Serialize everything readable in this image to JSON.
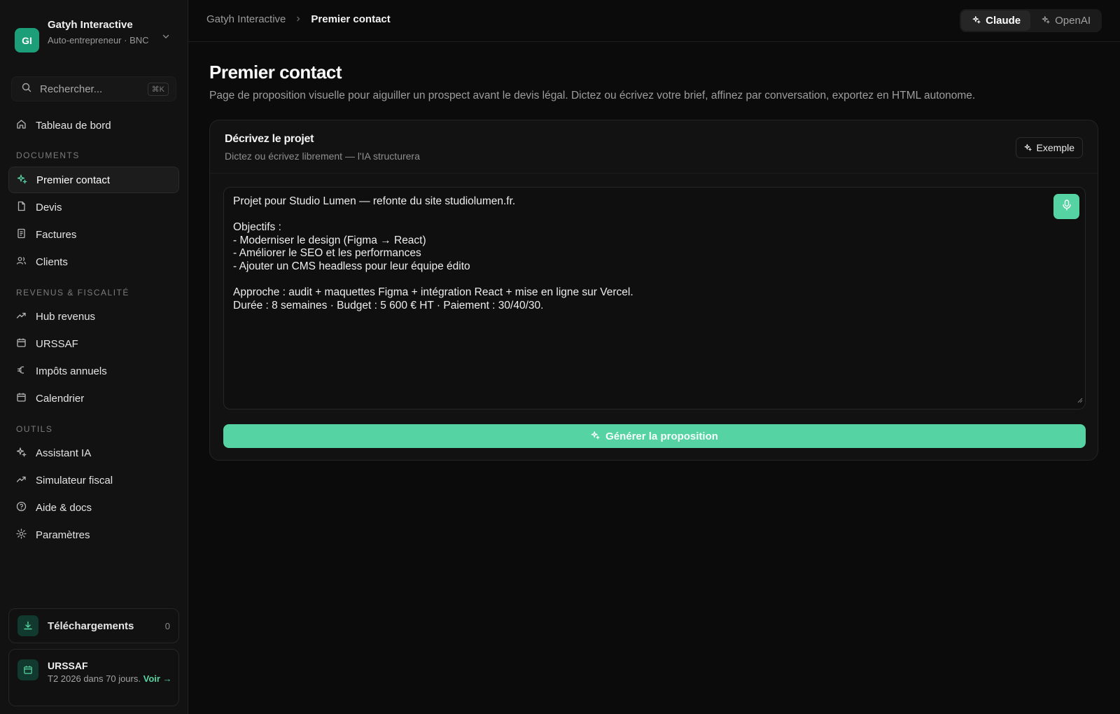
{
  "org": {
    "initials": "GI",
    "name": "Gatyh Interactive",
    "subtitle": "Auto-entrepreneur · BNC"
  },
  "search": {
    "placeholder": "Rechercher...",
    "shortcut": "⌘K"
  },
  "nav": {
    "dashboard": "Tableau de bord",
    "sections": {
      "documents": "DOCUMENTS",
      "revenus": "REVENUS & FISCALITÉ",
      "outils": "OUTILS"
    },
    "items": {
      "premier_contact": "Premier contact",
      "devis": "Devis",
      "factures": "Factures",
      "clients": "Clients",
      "hub_revenus": "Hub revenus",
      "urssaf": "URSSAF",
      "impots": "Impôts annuels",
      "calendrier": "Calendrier",
      "assistant": "Assistant IA",
      "simulateur": "Simulateur fiscal",
      "aide": "Aide & docs",
      "parametres": "Paramètres"
    },
    "active": "premier_contact"
  },
  "downloads": {
    "label": "Téléchargements",
    "count": "0"
  },
  "urssaf_card": {
    "title": "URSSAF",
    "desc": "T2 2026 dans 70 jours.",
    "link": "Voir →"
  },
  "breadcrumb": {
    "parent": "Gatyh Interactive",
    "current": "Premier contact"
  },
  "models": {
    "claude": "Claude",
    "openai": "OpenAI",
    "selected": "Claude"
  },
  "page": {
    "title": "Premier contact",
    "description": "Page de proposition visuelle pour aiguiller un prospect avant le devis légal. Dictez ou écrivez votre brief, affinez par conversation, exportez en HTML autonome."
  },
  "panel": {
    "title": "Décrivez le projet",
    "subtitle": "Dictez ou écrivez librement — l'IA structurera",
    "example_label": "Exemple",
    "brief": "Projet pour Studio Lumen — refonte du site studiolumen.fr.\n\nObjectifs :\n- Moderniser le design (Figma → React)\n- Améliorer le SEO et les performances\n- Ajouter un CMS headless pour leur équipe édito\n\nApproche : audit + maquettes Figma + intégration React + mise en ligne sur Vercel.\nDurée : 8 semaines · Budget : 5 600 € HT · Paiement : 30/40/30.",
    "generate_label": "Générer la proposition"
  },
  "colors": {
    "accent": "#56d3a2",
    "avatar": "#1c9e78",
    "background": "#0b0b0b",
    "sidebar": "#121212"
  }
}
